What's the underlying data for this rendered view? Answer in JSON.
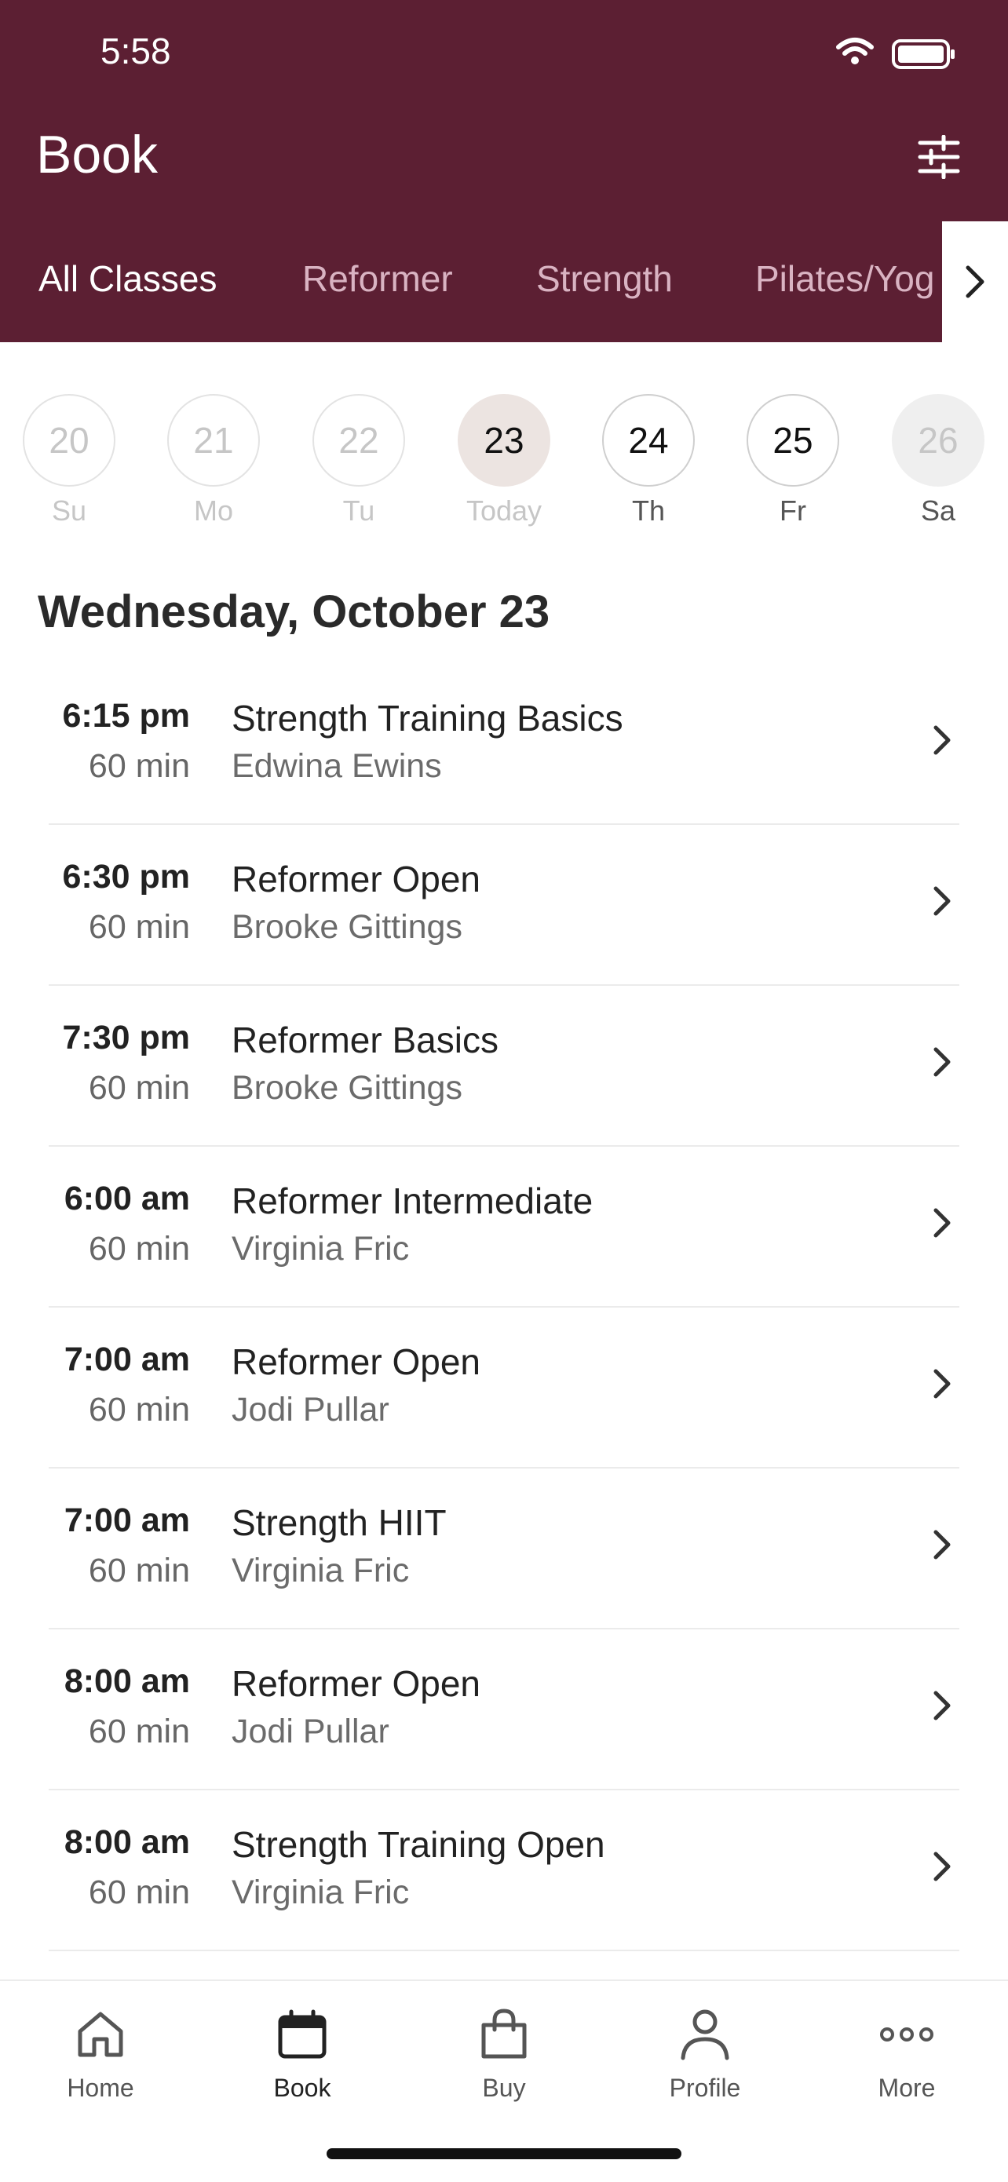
{
  "status_bar": {
    "time": "5:58"
  },
  "header": {
    "title": "Book"
  },
  "tabs": [
    {
      "label": "All Classes",
      "active": true
    },
    {
      "label": "Reformer",
      "active": false
    },
    {
      "label": "Strength",
      "active": false
    },
    {
      "label": "Pilates/Yog",
      "active": false
    }
  ],
  "dates": [
    {
      "num": "20",
      "day": "Su",
      "state": "past"
    },
    {
      "num": "21",
      "day": "Mo",
      "state": "past"
    },
    {
      "num": "22",
      "day": "Tu",
      "state": "past"
    },
    {
      "num": "23",
      "day": "Today",
      "state": "today"
    },
    {
      "num": "24",
      "day": "Th",
      "state": "future"
    },
    {
      "num": "25",
      "day": "Fr",
      "state": "future"
    },
    {
      "num": "26",
      "day": "Sa",
      "state": "dim"
    }
  ],
  "day_heading": "Wednesday, October 23",
  "classes": [
    {
      "time": "6:15 pm",
      "duration": "60 min",
      "name": "Strength Training Basics",
      "instructor": "Edwina Ewins"
    },
    {
      "time": "6:30 pm",
      "duration": "60 min",
      "name": "Reformer Open",
      "instructor": "Brooke Gittings"
    },
    {
      "time": "7:30 pm",
      "duration": "60 min",
      "name": "Reformer Basics",
      "instructor": "Brooke Gittings"
    },
    {
      "time": "6:00 am",
      "duration": "60 min",
      "name": "Reformer Intermediate",
      "instructor": "Virginia Fric"
    },
    {
      "time": "7:00 am",
      "duration": "60 min",
      "name": "Reformer Open",
      "instructor": "Jodi Pullar"
    },
    {
      "time": "7:00 am",
      "duration": "60 min",
      "name": "Strength HIIT",
      "instructor": "Virginia Fric"
    },
    {
      "time": "8:00 am",
      "duration": "60 min",
      "name": "Reformer Open",
      "instructor": "Jodi Pullar"
    },
    {
      "time": "8:00 am",
      "duration": "60 min",
      "name": "Strength Training Open",
      "instructor": "Virginia Fric"
    }
  ],
  "nav": [
    {
      "label": "Home",
      "icon": "home-icon",
      "active": false
    },
    {
      "label": "Book",
      "icon": "calendar-icon",
      "active": true
    },
    {
      "label": "Buy",
      "icon": "shopping-bag-icon",
      "active": false
    },
    {
      "label": "Profile",
      "icon": "user-icon",
      "active": false
    },
    {
      "label": "More",
      "icon": "more-icon",
      "active": false
    }
  ],
  "colors": {
    "header_bg": "#5c1f33",
    "tab_inactive": "#d9b3c2",
    "today_bg": "#ece4e1"
  }
}
